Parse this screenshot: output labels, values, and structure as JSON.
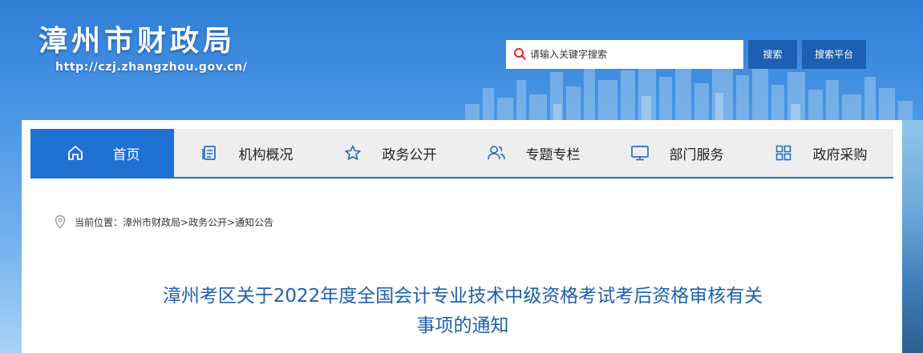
{
  "header": {
    "site_title": "漳州市财政局",
    "site_url": "http://czj.zhangzhou.gov.cn/"
  },
  "search": {
    "placeholder": "请输入关键字搜索",
    "search_label": "搜索",
    "platform_label": "搜索平台"
  },
  "nav": {
    "items": [
      {
        "label": "首页",
        "icon": "home-icon",
        "active": true
      },
      {
        "label": "机构概况",
        "icon": "document-icon"
      },
      {
        "label": "政务公开",
        "icon": "star-icon"
      },
      {
        "label": "专题专栏",
        "icon": "users-icon"
      },
      {
        "label": "部门服务",
        "icon": "monitor-icon"
      },
      {
        "label": "政府采购",
        "icon": "grid-icon"
      }
    ]
  },
  "breadcrumb": {
    "prefix": "当前位置：",
    "path": "漳州市财政局>政务公开>通知公告"
  },
  "article": {
    "title_line1": "漳州考区关于2022年度全国会计专业技术中级资格考试考后资格审核有关",
    "title_line2": "事项的通知"
  },
  "colors": {
    "nav_active": "#1f72d4",
    "title_blue": "#1f5fa9",
    "button_blue": "#1d5fb3"
  }
}
